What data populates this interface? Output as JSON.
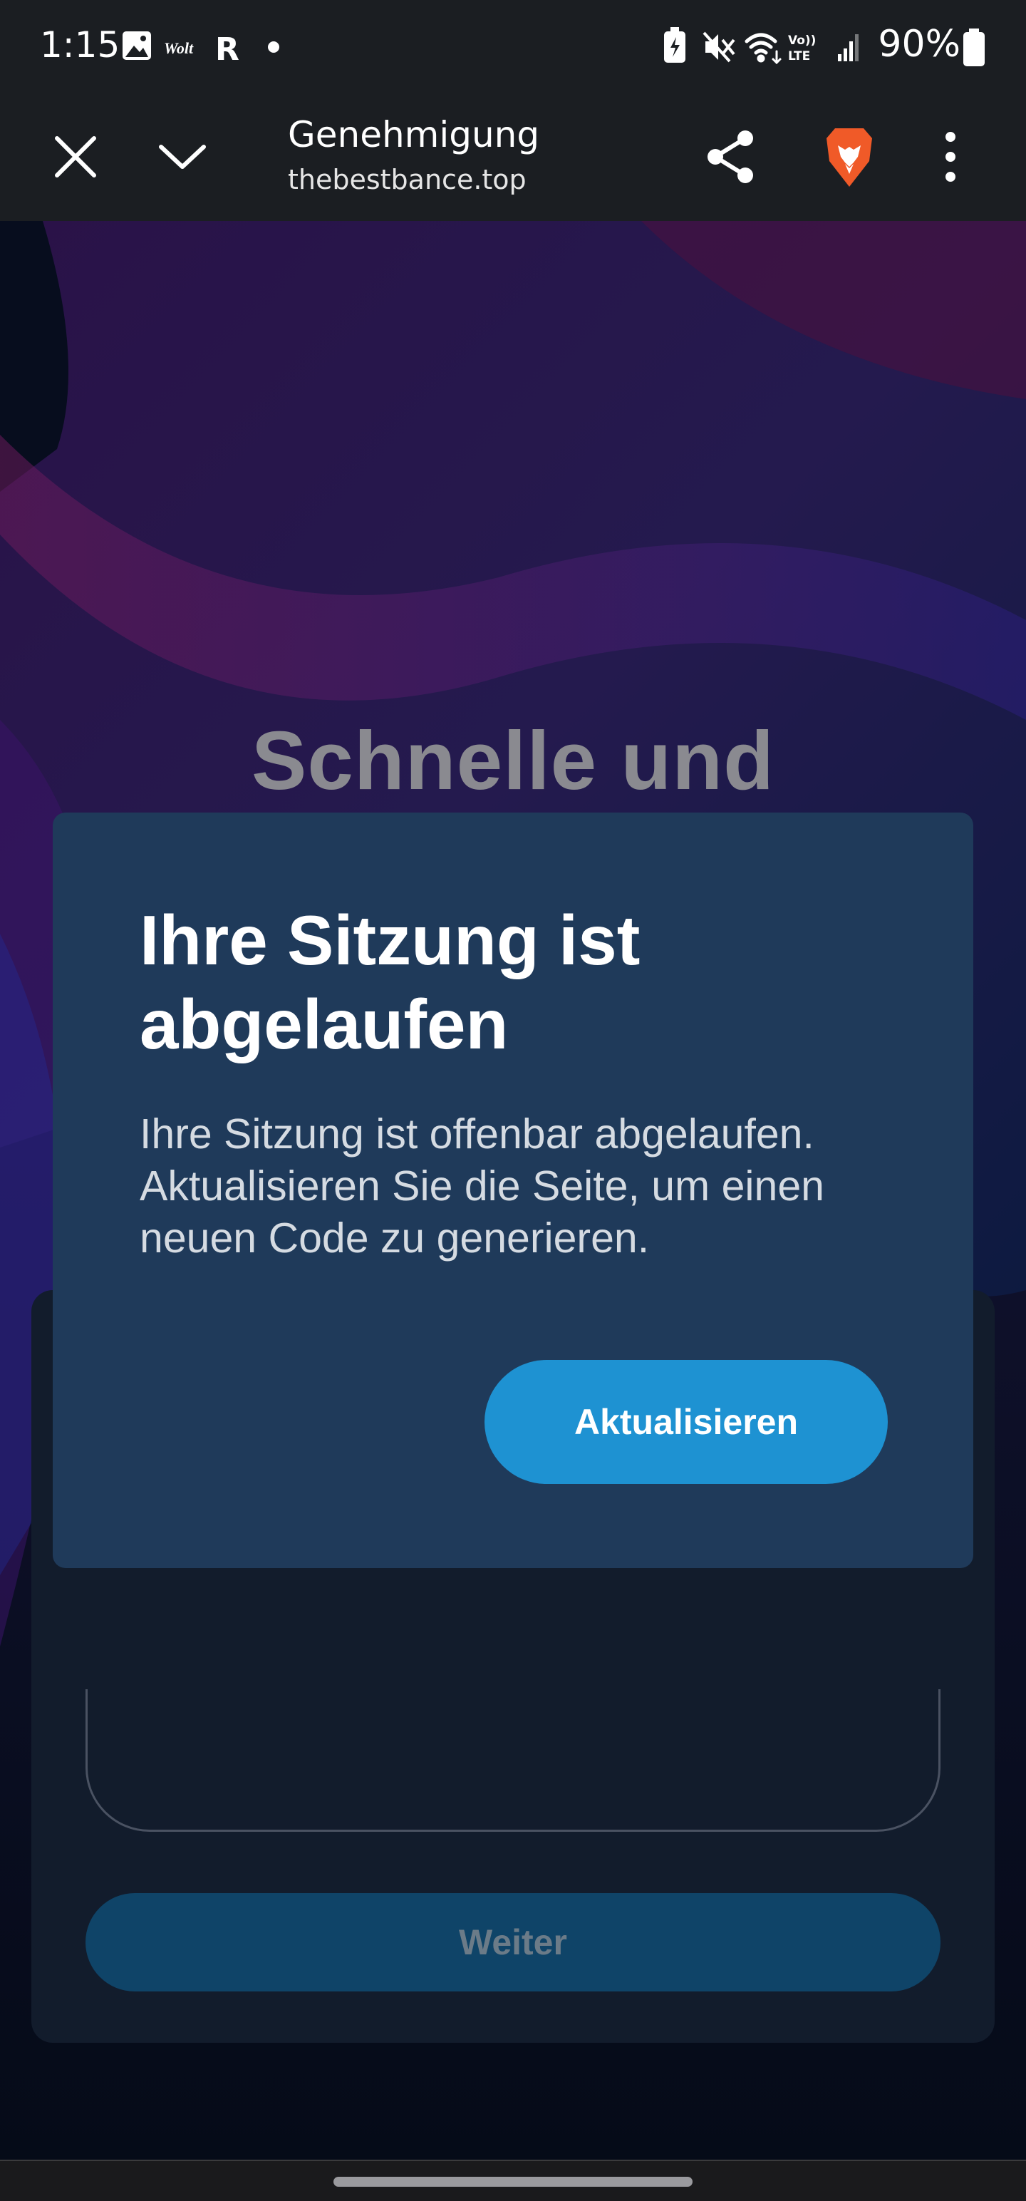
{
  "status_bar": {
    "time": "1:15",
    "left_icons": [
      "gallery-icon",
      "wolt-icon",
      "revolut-icon",
      "dot-icon"
    ],
    "wolt_label": "Wolt",
    "revolut_label": "R",
    "right_icons": [
      "battery-saver-icon",
      "mute-icon",
      "wifi-icon",
      "volte-icon",
      "signal-icon",
      "battery-icon"
    ],
    "volte_label_top": "Vo))",
    "volte_label_bottom": "LTE",
    "battery": "90%"
  },
  "toolbar": {
    "title": "Genehmigung",
    "url": "thebestbance.top",
    "icons": [
      "close-icon",
      "chevron-down-icon",
      "share-icon",
      "brave-lion-icon",
      "more-vertical-icon"
    ],
    "brave_color": "#f05a28"
  },
  "page": {
    "hero_heading": "Schnelle und",
    "continue_button": "Weiter"
  },
  "modal": {
    "title": "Ihre Sitzung ist abgelaufen",
    "body": "Ihre Sitzung ist offenbar abgelaufen. Aktualisieren Sie die Seite, um einen neuen Code zu generieren.",
    "button": "Aktualisieren"
  },
  "colors": {
    "toolbar_bg": "#1b1e22",
    "modal_bg": "#1f3a5a",
    "modal_button": "#1e92d2",
    "page_bg": "#050b18"
  }
}
